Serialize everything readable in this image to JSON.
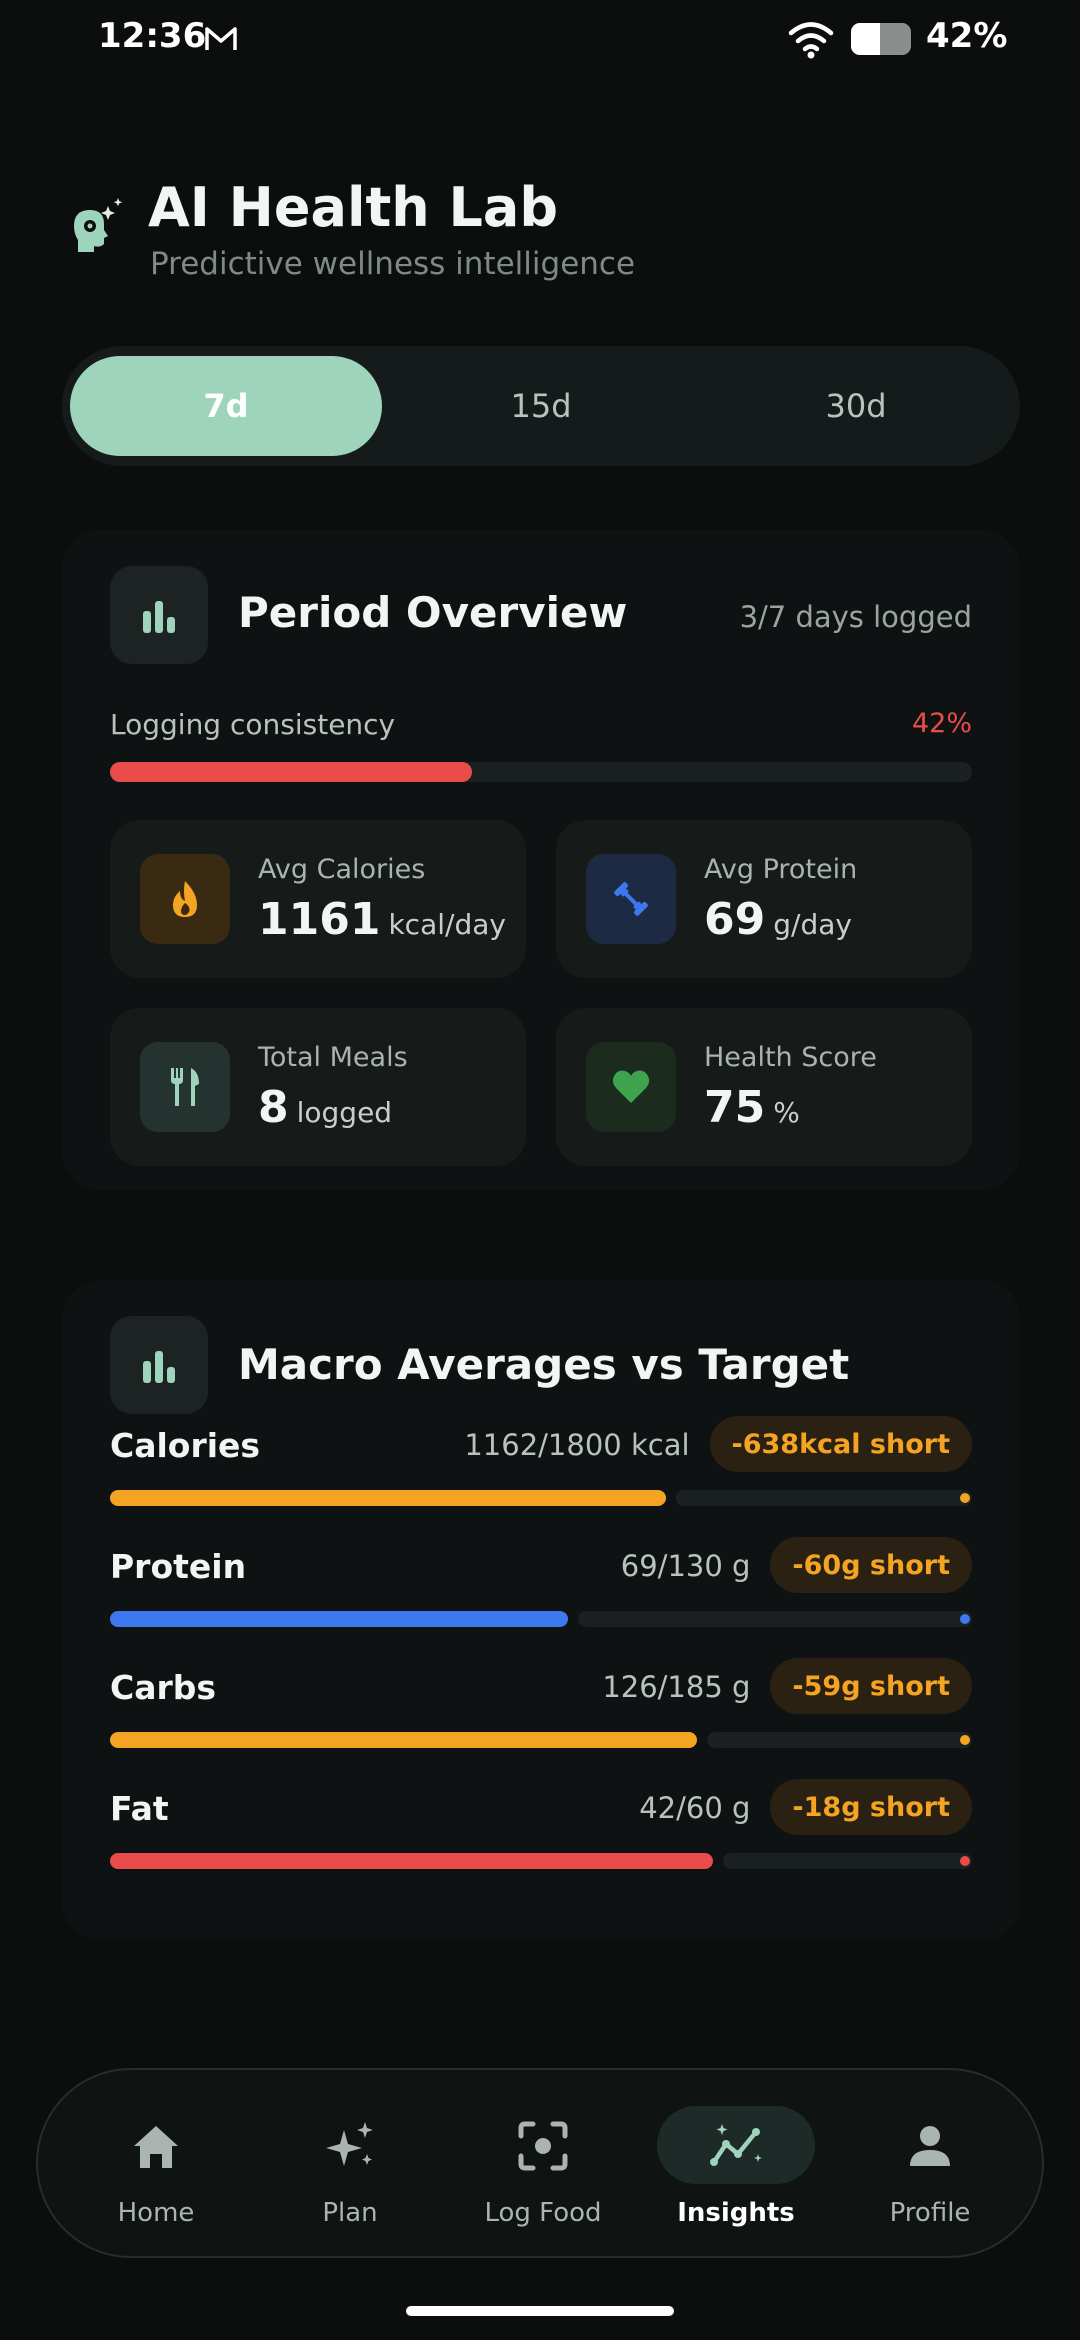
{
  "status_bar": {
    "time": "12:36",
    "battery": "42%"
  },
  "header": {
    "title": "AI Health Lab",
    "subtitle": "Predictive wellness intelligence"
  },
  "range_tabs": [
    {
      "label": "7d",
      "active": true
    },
    {
      "label": "15d",
      "active": false
    },
    {
      "label": "30d",
      "active": false
    }
  ],
  "overview": {
    "title": "Period Overview",
    "days_logged": "3/7 days logged",
    "consistency_label": "Logging consistency",
    "consistency_value": "42%",
    "consistency_fraction": 0.42,
    "stats": [
      {
        "label": "Avg Calories",
        "value": "1161",
        "unit": "kcal/day",
        "icon": "flame-icon"
      },
      {
        "label": "Avg Protein",
        "value": "69",
        "unit": "g/day",
        "icon": "dumbbell-icon"
      },
      {
        "label": "Total Meals",
        "value": "8",
        "unit": "logged",
        "icon": "fork-knife-icon"
      },
      {
        "label": "Health Score",
        "value": "75",
        "unit": "%",
        "icon": "heart-icon"
      }
    ]
  },
  "macros": {
    "title": "Macro Averages vs Target",
    "items": [
      {
        "name": "Calories",
        "amount": "1162/1800 kcal",
        "status": "-638kcal short",
        "fraction": 0.645,
        "color": "#f4a422"
      },
      {
        "name": "Protein",
        "amount": "69/130 g",
        "status": "-60g short",
        "fraction": 0.531,
        "color": "#3d78ef"
      },
      {
        "name": "Carbs",
        "amount": "126/185 g",
        "status": "-59g short",
        "fraction": 0.681,
        "color": "#f4a422"
      },
      {
        "name": "Fat",
        "amount": "42/60 g",
        "status": "-18g short",
        "fraction": 0.7,
        "color": "#ea4c4c"
      }
    ]
  },
  "nav": [
    {
      "label": "Home",
      "icon": "home-icon",
      "active": false
    },
    {
      "label": "Plan",
      "icon": "sparkle-icon",
      "active": false
    },
    {
      "label": "Log Food",
      "icon": "scan-icon",
      "active": false
    },
    {
      "label": "Insights",
      "icon": "insights-icon",
      "active": true
    },
    {
      "label": "Profile",
      "icon": "profile-icon",
      "active": false
    }
  ],
  "colors": {
    "accent": "#9fd4bc",
    "consistency": "#ea4c4c",
    "warning": "#f4a422"
  }
}
